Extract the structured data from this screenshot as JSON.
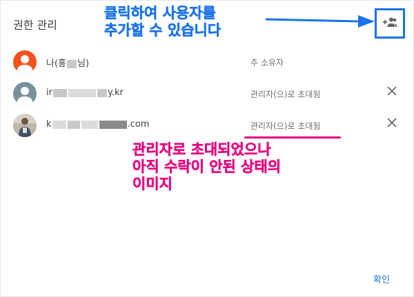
{
  "dialog": {
    "title": "권한 관리",
    "confirm_label": "확인"
  },
  "members": [
    {
      "name": "나(홍",
      "name_tail": "님)",
      "role": "주 소유자",
      "avatar": "person-avatar-orange",
      "removable": false
    },
    {
      "name": "ir",
      "name_tail": "y.kr",
      "role": "관리자(으)로 초대됨",
      "avatar": "person-avatar-gray",
      "removable": true
    },
    {
      "name": "k",
      "name_tail": ".com",
      "role": "관리자(으)로 초대됨",
      "avatar": "person-avatar-photo",
      "removable": true
    }
  ],
  "annotations": {
    "add_user_note_line1": "클릭하여 사용자를",
    "add_user_note_line2": "추가할 수 있습니다",
    "invited_note_line1": "관리자로 초대되었으나",
    "invited_note_line2": "아직 수락이 안된 상태의",
    "invited_note_line3": "이미지"
  },
  "colors": {
    "accent": "#1a73e8",
    "highlight": "#e6007e",
    "avatar_orange": "#f4511e",
    "avatar_gray": "#78909c"
  },
  "icons": {
    "add_user": "person-add-icon",
    "remove": "close-icon"
  }
}
